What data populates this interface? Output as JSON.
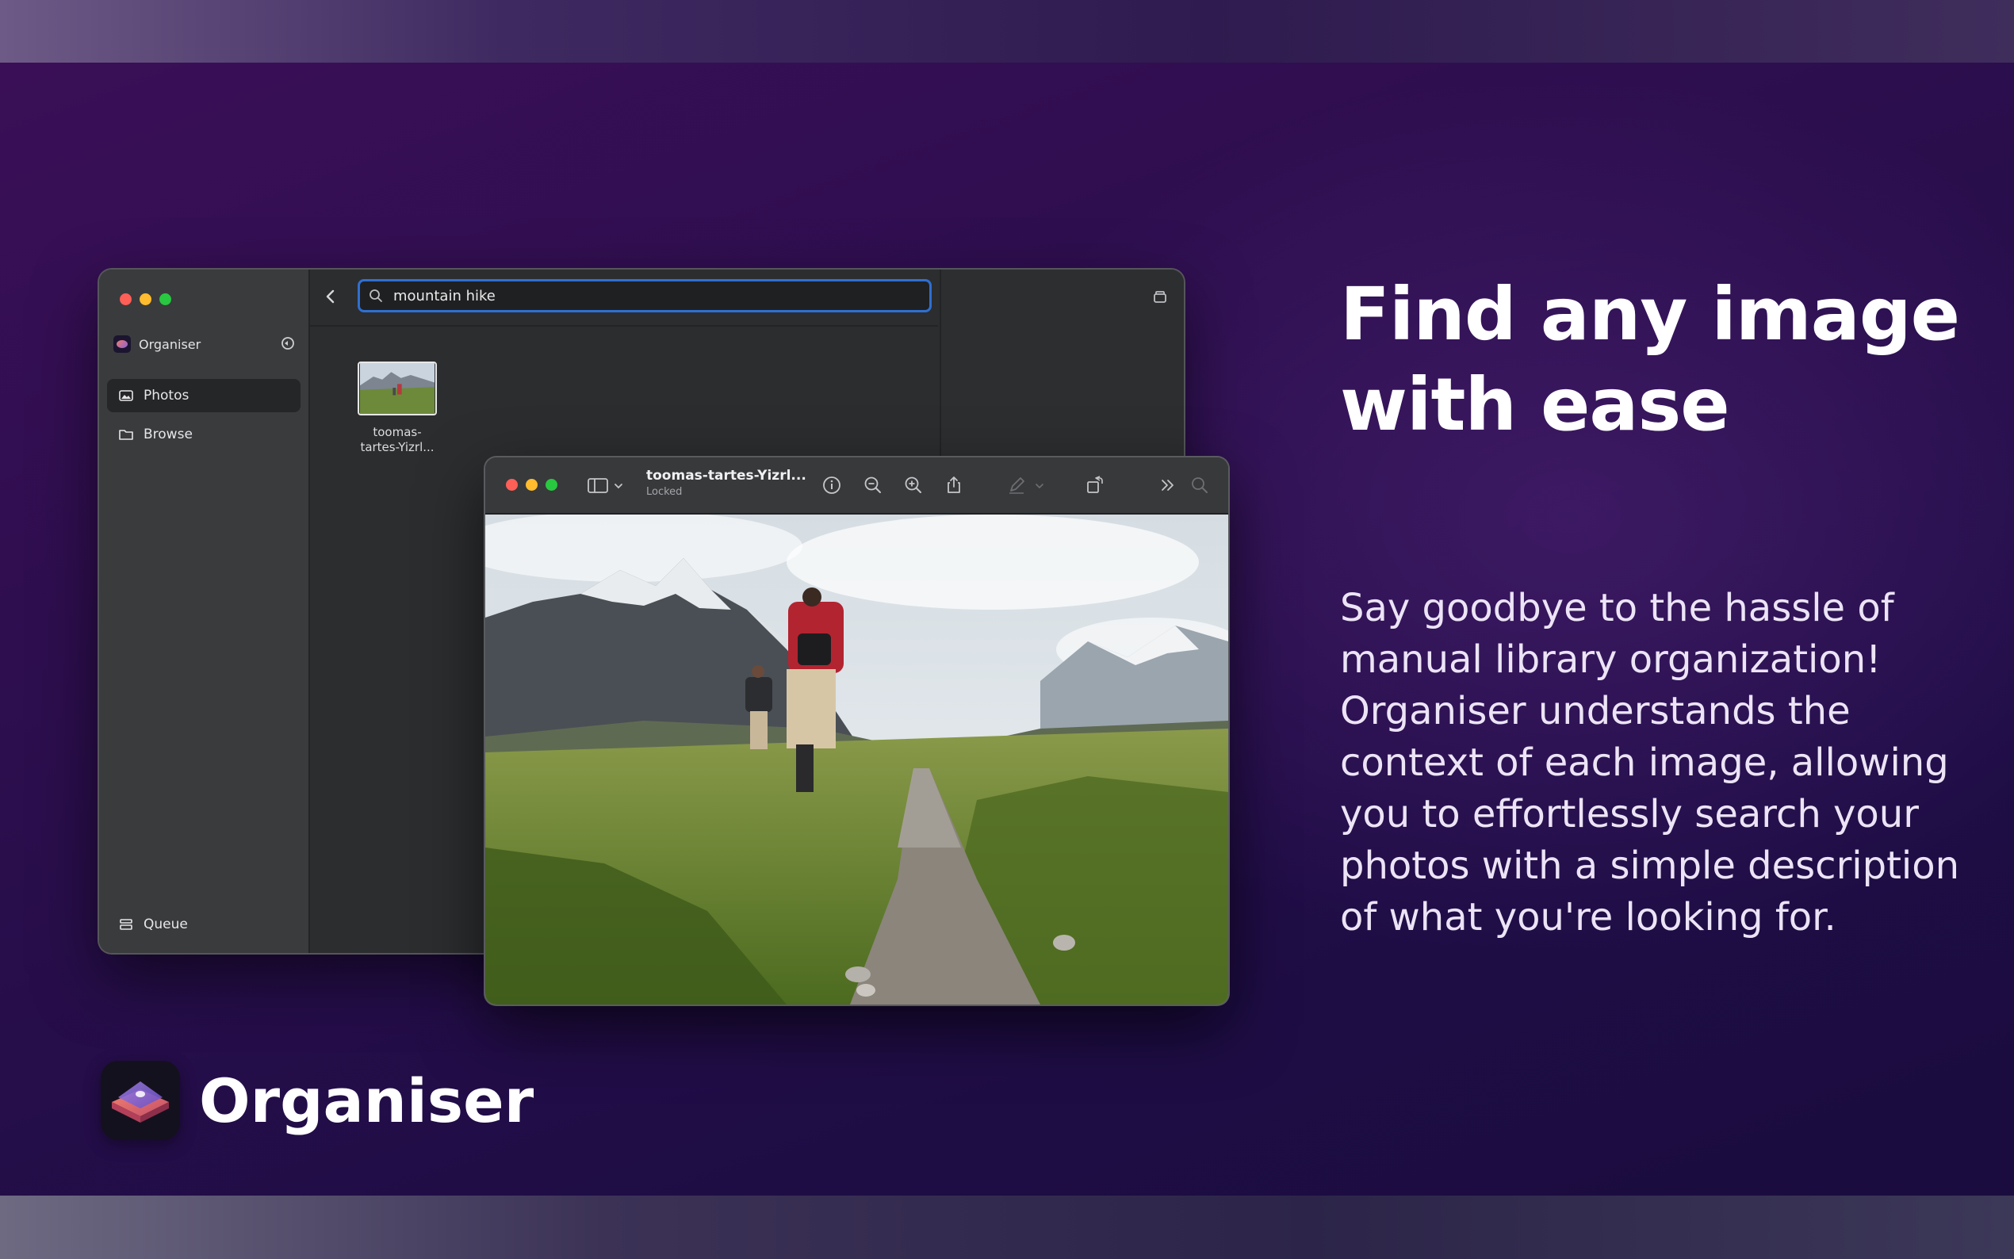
{
  "marketing": {
    "headline_line1": "Find any image",
    "headline_line2": "with ease",
    "body": "Say goodbye to the hassle of manual library organization! Organiser understands the context of each image, allowing you to effortlessly search your photos with a simple description of what you're looking for.",
    "brand_name": "Organiser"
  },
  "main_window": {
    "sidebar": {
      "app_name": "Organiser",
      "items": [
        {
          "label": "Photos",
          "icon": "photo-icon",
          "selected": true
        },
        {
          "label": "Browse",
          "icon": "folder-icon",
          "selected": false
        }
      ],
      "queue_label": "Queue"
    },
    "search": {
      "value": "mountain hike"
    },
    "results": [
      {
        "label_line1": "toomas-",
        "label_line2": "tartes-Yizrl..."
      }
    ]
  },
  "preview_window": {
    "title": "toomas-tartes-Yizrl...",
    "subtitle": "Locked",
    "toolbar_icons": [
      "sidebar-toggle-icon",
      "info-icon",
      "zoom-out-icon",
      "zoom-in-icon",
      "share-icon",
      "markup-icon",
      "rotate-icon",
      "more-icon",
      "search-icon"
    ]
  },
  "colors": {
    "accent_blue": "#2f6fd1",
    "traffic_red": "#fe5f57",
    "traffic_yellow": "#febc2e",
    "traffic_green": "#28c840"
  }
}
